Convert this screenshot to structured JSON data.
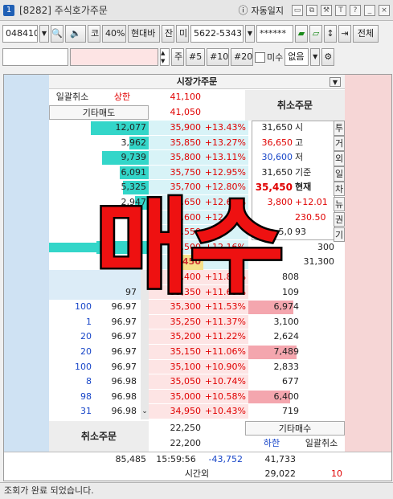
{
  "window": {
    "num": "1",
    "title": "[8282] 주식호가주문",
    "journal_label": "자동일지",
    "icons": [
      "info-circle-icon",
      "restore-icon",
      "duplicate-icon",
      "tools-icon",
      "text-icon",
      "help-icon",
      "minimize-icon",
      "close-icon"
    ]
  },
  "toolbar": {
    "code": "048410",
    "market": "코",
    "margin": "40%",
    "stock_name": "현대바",
    "jan": "잔",
    "mi": "미",
    "account": "5622-5343",
    "password": "******",
    "all_label": "전체"
  },
  "toolbar2": {
    "ju": "주",
    "q1": "#5",
    "q2": "#10",
    "q3": "#20",
    "misu_label": "미수",
    "none_label": "없음"
  },
  "order": {
    "market_order_label": "시장가주문",
    "bulk_cancel_label": "일괄취소",
    "upper_limit_label": "상한",
    "upper_limit_price": "41,100",
    "other_sell_label": "기타매도",
    "other_sell_price": "41,050",
    "cancel_order_label": "취소주문",
    "other_buy_label": "기타매수",
    "lower_limit_label": "하한",
    "bulk_cancel_label2": "일괄취소",
    "ask_prices": [
      {
        "qty": "12,077",
        "price": "35,900",
        "pct": "+13.43%",
        "bar": 1.0
      },
      {
        "qty": "3,962",
        "price": "35,850",
        "pct": "+13.27%",
        "bar": 0.33
      },
      {
        "qty": "9,739",
        "price": "35,800",
        "pct": "+13.11%",
        "bar": 0.81
      },
      {
        "qty": "6,091",
        "price": "35,750",
        "pct": "+12.95%",
        "bar": 0.5
      },
      {
        "qty": "5,325",
        "price": "35,700",
        "pct": "+12.80%",
        "bar": 0.44
      },
      {
        "qty": "2,947",
        "price": "35,650",
        "pct": "+12.64%",
        "bar": 0.24
      },
      {
        "qty": "",
        "price": "35,600",
        "pct": "+12.48%",
        "bar": 0
      },
      {
        "qty": "",
        "price": "35,550",
        "pct": "",
        "bar": 0
      },
      {
        "qty": "",
        "price": "35,500",
        "pct": "+12.16%",
        "bar": 0.9
      },
      {
        "qty": "",
        "price": "35,450",
        "pct": "",
        "bar": 0
      }
    ],
    "bid_prices": [
      {
        "cnt": "",
        "rate": "",
        "price": "35,400",
        "pct": "+11.85%",
        "qty": "808",
        "bar": 0
      },
      {
        "cnt": "",
        "rate": "97",
        "price": "35,350",
        "pct": "+11.69%",
        "qty": "109",
        "bar": 0
      },
      {
        "cnt": "100",
        "rate": "96.97",
        "price": "35,300",
        "pct": "+11.53%",
        "qty": "6,974",
        "bar": 0.93
      },
      {
        "cnt": "1",
        "rate": "96.97",
        "price": "35,250",
        "pct": "+11.37%",
        "qty": "3,100",
        "bar": 0
      },
      {
        "cnt": "20",
        "rate": "96.97",
        "price": "35,200",
        "pct": "+11.22%",
        "qty": "2,624",
        "bar": 0
      },
      {
        "cnt": "20",
        "rate": "96.97",
        "price": "35,150",
        "pct": "+11.06%",
        "qty": "7,489",
        "bar": 1.0
      },
      {
        "cnt": "100",
        "rate": "96.97",
        "price": "35,100",
        "pct": "+10.90%",
        "qty": "2,833",
        "bar": 0
      },
      {
        "cnt": "8",
        "rate": "96.98",
        "price": "35,050",
        "pct": "+10.74%",
        "qty": "677",
        "bar": 0
      },
      {
        "cnt": "98",
        "rate": "96.98",
        "price": "35,000",
        "pct": "+10.58%",
        "qty": "6,400",
        "bar": 0.86
      },
      {
        "cnt": "31",
        "rate": "96.98",
        "price": "34,950",
        "pct": "+10.43%",
        "qty": "719",
        "bar": 0
      }
    ],
    "info": [
      {
        "val": "31,650",
        "lbl": "시"
      },
      {
        "val": "36,650",
        "lbl": "고"
      },
      {
        "val": "30,600",
        "lbl": "저"
      },
      {
        "val": "31,650",
        "lbl": "기준"
      },
      {
        "val": "35,450",
        "lbl": "현재"
      },
      {
        "val": "3,800",
        "lbl": "+12.01"
      },
      {
        "val": "",
        "lbl": "230.50"
      },
      {
        "val": "5,0",
        "lbl": "93"
      },
      {
        "val": "",
        "lbl": "300"
      },
      {
        "val": "",
        "lbl": "31,300"
      }
    ],
    "side_tabs": [
      "투",
      "거",
      "외",
      "일",
      "차",
      "뉴",
      "권",
      "기"
    ],
    "current_left": "450",
    "bottom": {
      "ask_total_1": "22,250",
      "ask_total_2": "22,200",
      "ask_sum": "85,485",
      "time": "15:59:56",
      "diff": "-43,752",
      "bid_sum": "41,733",
      "after_hours_label": "시간외",
      "after_hours_qty": "29,022",
      "after_hours_cnt": "10"
    }
  },
  "overlay_text": "매수",
  "status_text": "조회가 완료 되었습니다.",
  "colors": {
    "ask_bar": "#33d6c9",
    "bid_bar": "#f4a6ae",
    "ask_price_bg": "#d8f3f7",
    "bid_price_bg": "#fde4e4",
    "overlay": "#ee1111"
  }
}
